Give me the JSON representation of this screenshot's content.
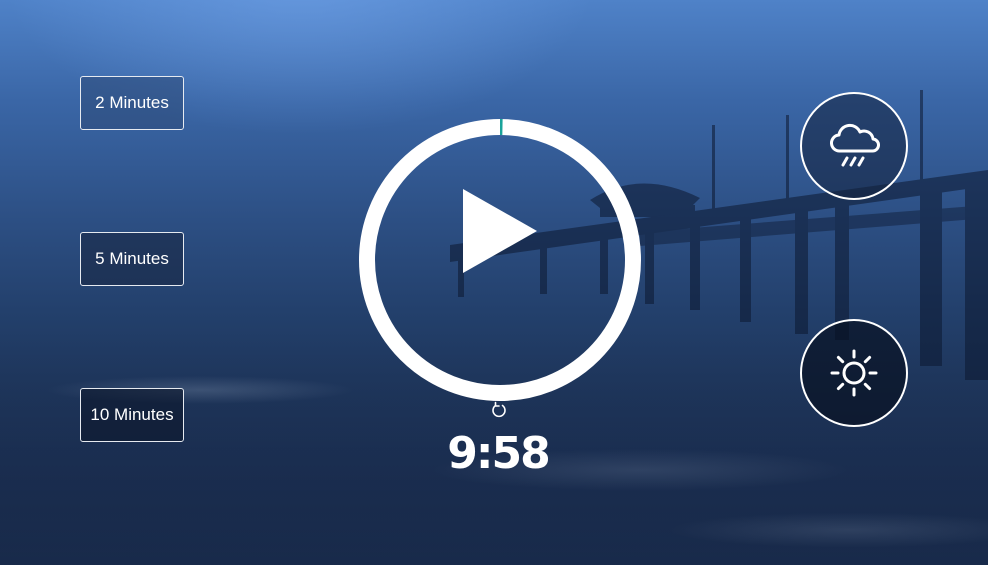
{
  "durations": [
    {
      "label": "2 Minutes"
    },
    {
      "label": "5 Minutes"
    },
    {
      "label": "10 Minutes"
    }
  ],
  "timer": {
    "display": "9:58",
    "progress_fraction": 0.003
  },
  "sound_buttons": {
    "rain_icon": "cloud-rain-icon",
    "sun_icon": "sun-icon"
  },
  "colors": {
    "progress_accent": "#1aa39a",
    "ring": "#ffffff"
  }
}
